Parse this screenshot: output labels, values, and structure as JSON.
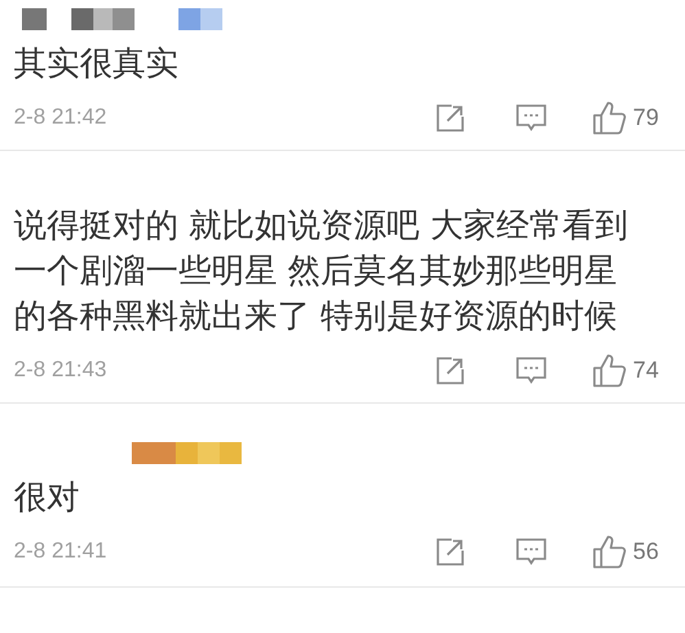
{
  "comments": [
    {
      "user_redacted": true,
      "text": "其实很真实",
      "time": "2-8 21:42",
      "likes": "79"
    },
    {
      "user_redacted": false,
      "text": "说得挺对的 就比如说资源吧 大家经常看到一个剧溜一些明星 然后莫名其妙那些明星的各种黑料就出来了 特别是好资源的时候",
      "time": "2-8 21:43",
      "likes": "74"
    },
    {
      "user_redacted": true,
      "text": "很对",
      "time": "2-8 21:41",
      "likes": "56"
    }
  ]
}
